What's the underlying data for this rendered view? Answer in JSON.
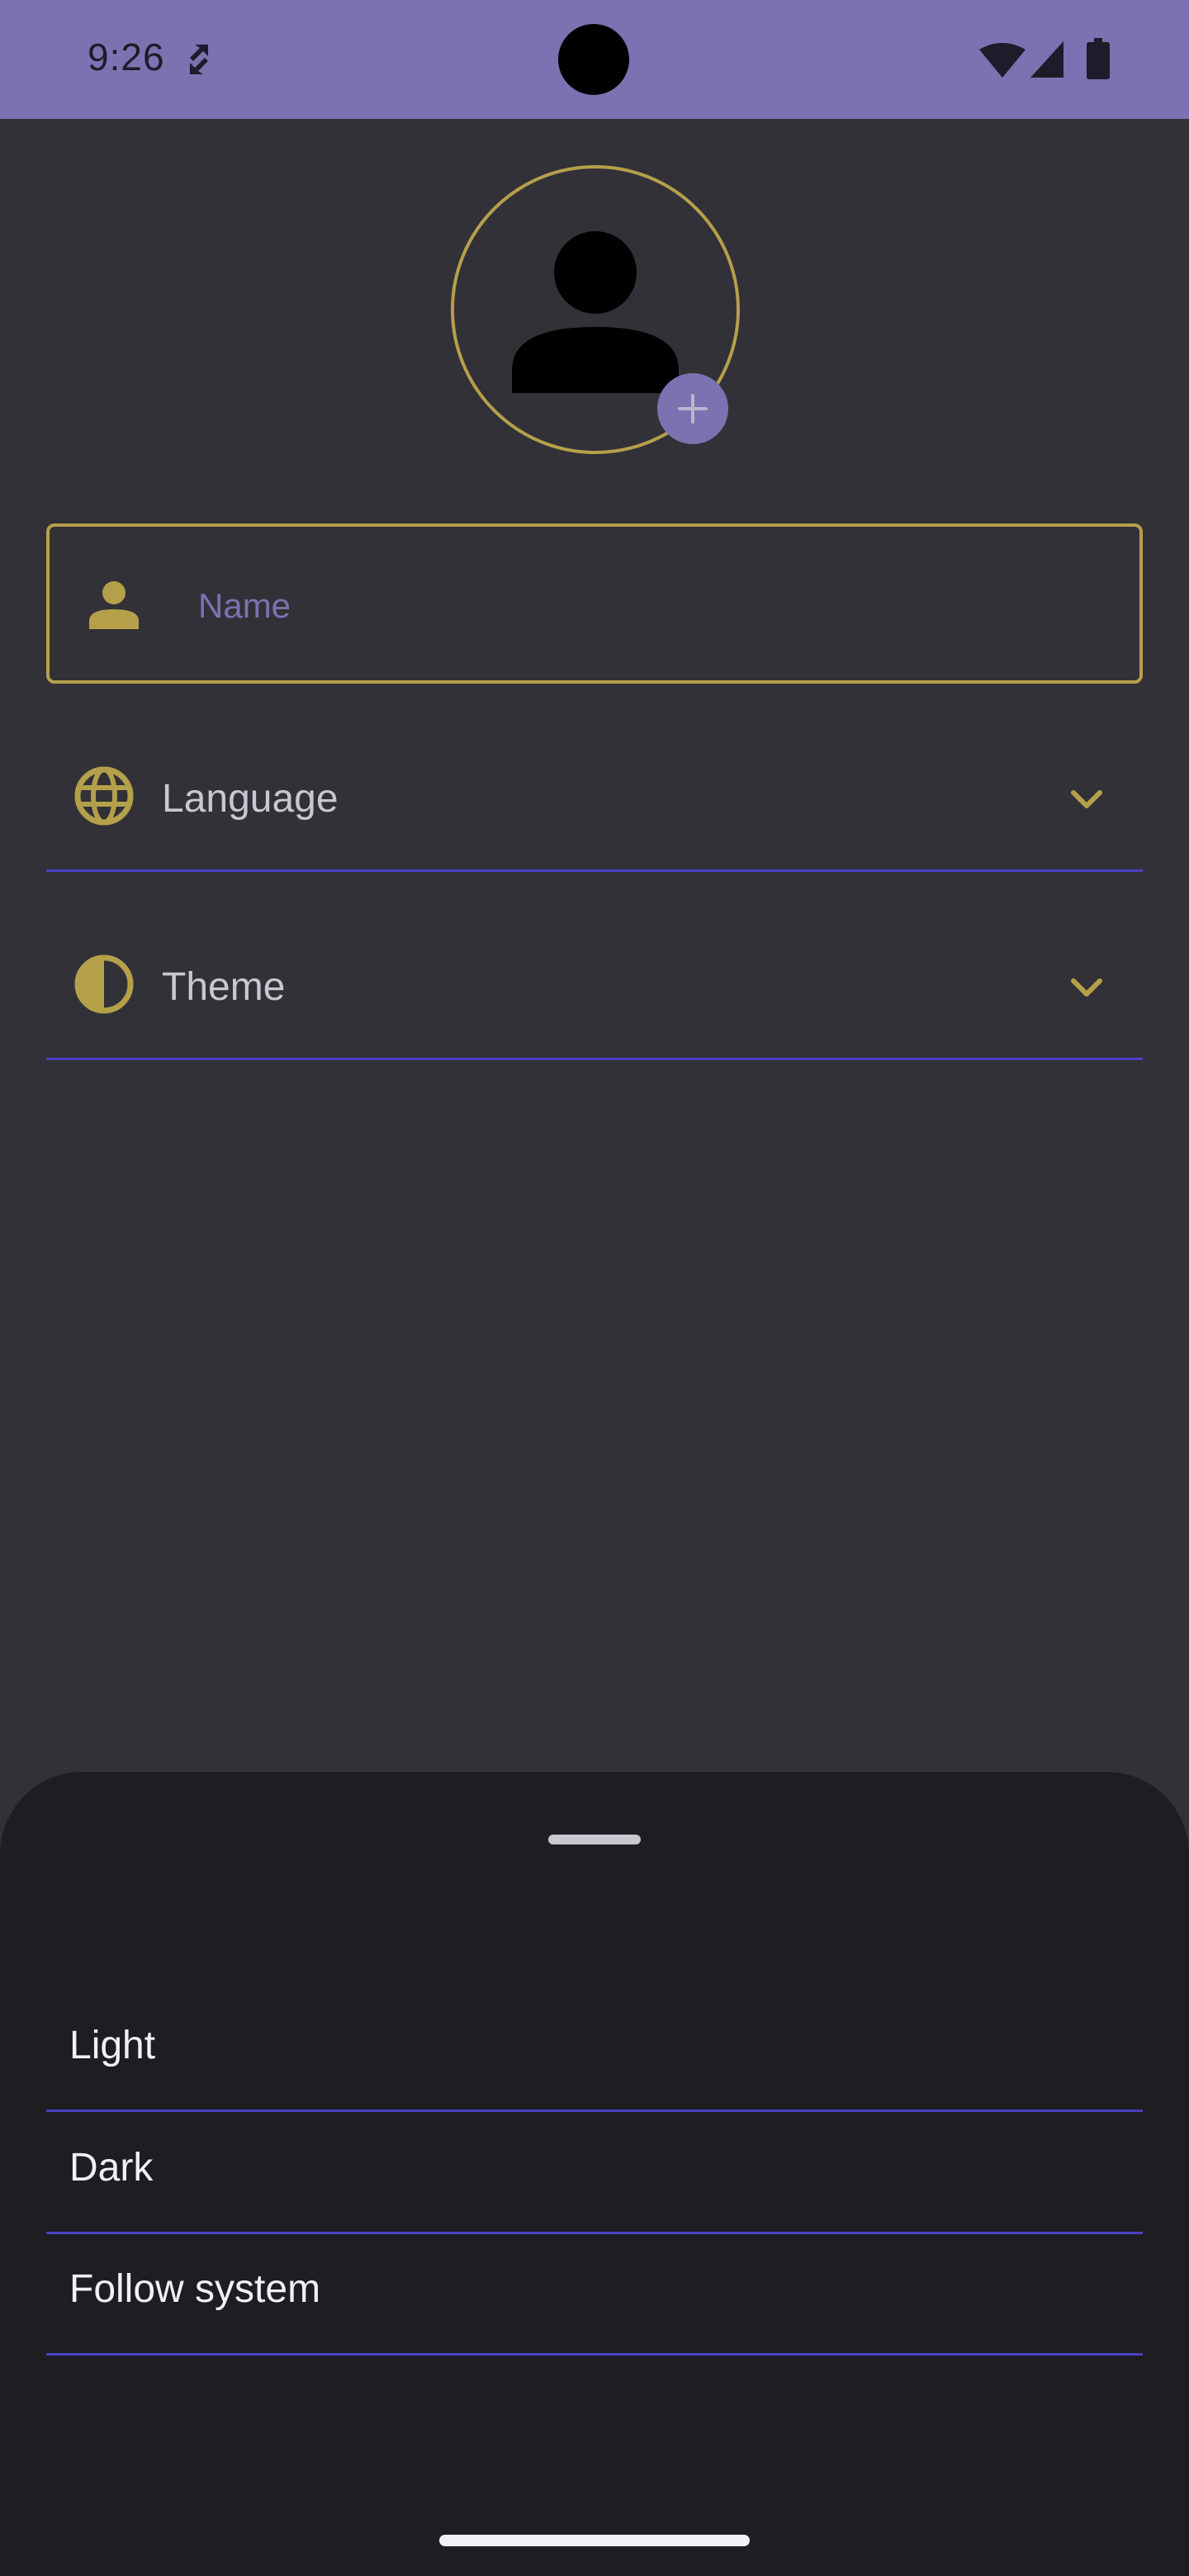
{
  "status_bar": {
    "time": "9:26",
    "icons": [
      "sync-icon",
      "wifi-icon",
      "signal-icon",
      "battery-icon"
    ]
  },
  "profile": {
    "avatar_icon": "person-icon",
    "add_photo_icon": "plus-icon"
  },
  "name_field": {
    "label": "Name",
    "value": ""
  },
  "settings": {
    "language": {
      "label": "Language",
      "icon": "globe-icon"
    },
    "theme": {
      "label": "Theme",
      "icon": "contrast-icon"
    }
  },
  "theme_sheet": {
    "options": [
      "Light",
      "Dark",
      "Follow system"
    ]
  },
  "colors": {
    "status_bar": "#7b72b1",
    "background": "#323137",
    "sheet_background": "#1e1d22",
    "accent_gold": "#b5a04a",
    "accent_purple": "#7b72b1",
    "divider": "#4b3fc4"
  }
}
